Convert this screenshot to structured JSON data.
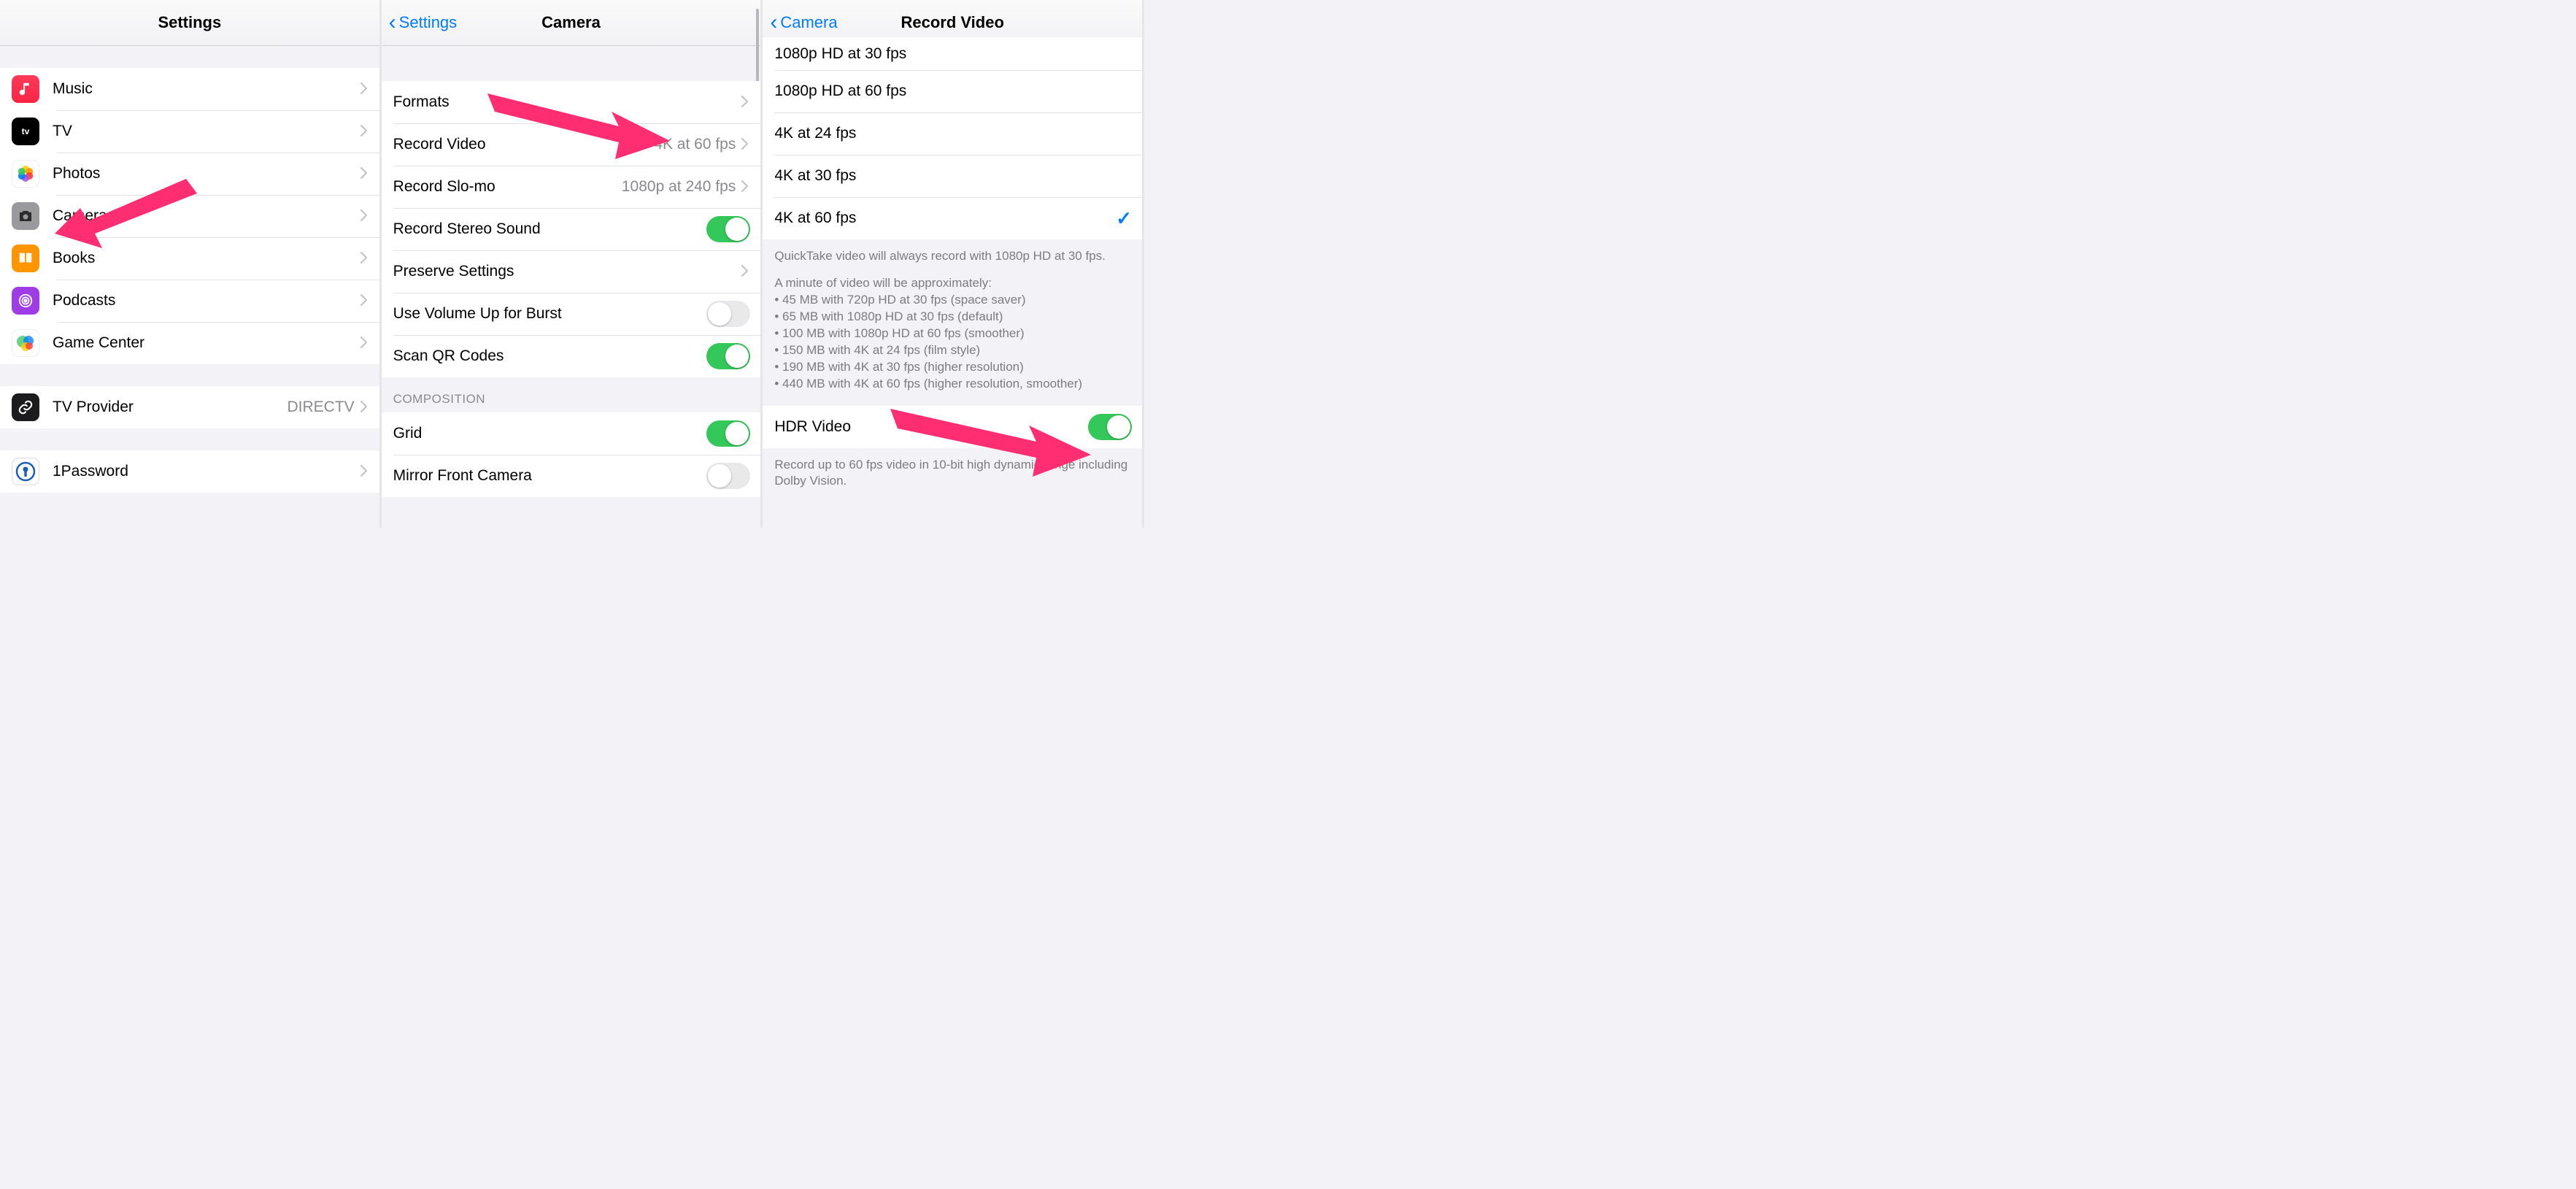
{
  "pane1": {
    "title": "Settings",
    "group1": [
      {
        "key": "music",
        "label": "Music"
      },
      {
        "key": "tv",
        "label": "TV"
      },
      {
        "key": "photos",
        "label": "Photos"
      },
      {
        "key": "camera",
        "label": "Camera"
      },
      {
        "key": "books",
        "label": "Books"
      },
      {
        "key": "podcasts",
        "label": "Podcasts"
      },
      {
        "key": "gamecenter",
        "label": "Game Center"
      }
    ],
    "group2": [
      {
        "key": "tvprovider",
        "label": "TV Provider",
        "detail": "DIRECTV"
      }
    ],
    "group3": [
      {
        "key": "1password",
        "label": "1Password"
      }
    ]
  },
  "pane2": {
    "back": "Settings",
    "title": "Camera",
    "group1": [
      {
        "key": "formats",
        "label": "Formats",
        "kind": "disclosure"
      },
      {
        "key": "recvideo",
        "label": "Record Video",
        "detail": "4K at 60 fps",
        "kind": "disclosure"
      },
      {
        "key": "recslomo",
        "label": "Record Slo-mo",
        "detail": "1080p at 240 fps",
        "kind": "disclosure"
      },
      {
        "key": "stereo",
        "label": "Record Stereo Sound",
        "kind": "toggle",
        "on": true
      },
      {
        "key": "preserve",
        "label": "Preserve Settings",
        "kind": "disclosure"
      },
      {
        "key": "volburst",
        "label": "Use Volume Up for Burst",
        "kind": "toggle",
        "on": false
      },
      {
        "key": "qr",
        "label": "Scan QR Codes",
        "kind": "toggle",
        "on": true
      }
    ],
    "group2_header": "COMPOSITION",
    "group2": [
      {
        "key": "grid",
        "label": "Grid",
        "kind": "toggle",
        "on": true
      },
      {
        "key": "mirror",
        "label": "Mirror Front Camera",
        "kind": "toggle",
        "on": false
      }
    ]
  },
  "pane3": {
    "back": "Camera",
    "title": "Record Video",
    "options": [
      {
        "key": "1080p30",
        "label": "1080p HD at 30 fps",
        "selected": false
      },
      {
        "key": "1080p60",
        "label": "1080p HD at 60 fps",
        "selected": false
      },
      {
        "key": "4k24",
        "label": "4K at 24 fps",
        "selected": false
      },
      {
        "key": "4k30",
        "label": "4K at 30 fps",
        "selected": false
      },
      {
        "key": "4k60",
        "label": "4K at 60 fps",
        "selected": true
      }
    ],
    "footer1_line1": "QuickTake video will always record with 1080p HD at 30 fps.",
    "footer1_line2": "A minute of video will be approximately:",
    "footer1_bullets": [
      "45 MB with 720p HD at 30 fps (space saver)",
      "65 MB with 1080p HD at 30 fps (default)",
      "100 MB with 1080p HD at 60 fps (smoother)",
      "150 MB with 4K at 24 fps (film style)",
      "190 MB with 4K at 30 fps (higher resolution)",
      "440 MB with 4K at 60 fps (higher resolution, smoother)"
    ],
    "hdr": {
      "label": "HDR Video",
      "on": true
    },
    "footer2": "Record up to 60 fps video in 10-bit high dynamic range including Dolby Vision."
  }
}
